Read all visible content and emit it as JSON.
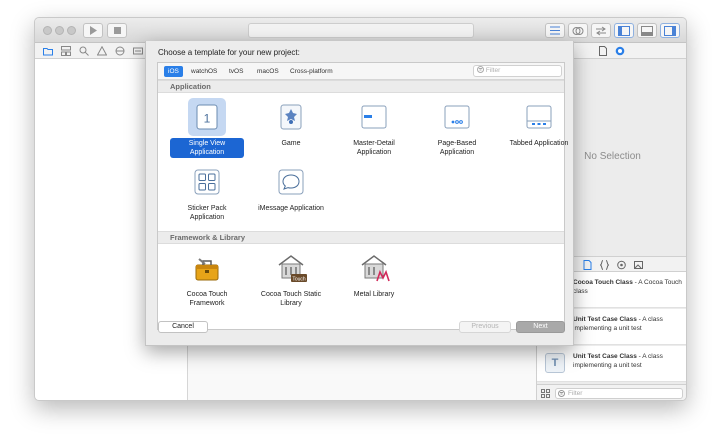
{
  "dialog": {
    "title": "Choose a template for your new project:",
    "platform_tabs": [
      "iOS",
      "watchOS",
      "tvOS",
      "macOS",
      "Cross-platform"
    ],
    "selected_tab": "iOS",
    "filter_placeholder": "Filter",
    "sections": [
      {
        "title": "Application",
        "templates": [
          {
            "label": "Single View Application",
            "icon": "single-view-icon",
            "selected": true
          },
          {
            "label": "Game",
            "icon": "game-icon"
          },
          {
            "label": "Master-Detail Application",
            "icon": "master-detail-icon"
          },
          {
            "label": "Page-Based Application",
            "icon": "page-based-icon"
          },
          {
            "label": "Tabbed Application",
            "icon": "tabbed-icon"
          },
          {
            "label": "Sticker Pack Application",
            "icon": "sticker-pack-icon"
          },
          {
            "label": "iMessage Application",
            "icon": "imessage-icon"
          }
        ]
      },
      {
        "title": "Framework & Library",
        "templates": [
          {
            "label": "Cocoa Touch Framework",
            "icon": "toolbox-icon"
          },
          {
            "label": "Cocoa Touch Static Library",
            "icon": "static-library-icon",
            "badge": "Touch"
          },
          {
            "label": "Metal Library",
            "icon": "metal-library-icon"
          }
        ]
      }
    ],
    "single_view_glyph": "1",
    "buttons": {
      "cancel": "Cancel",
      "previous": "Previous",
      "next": "Next"
    }
  },
  "inspector": {
    "no_selection": "No Selection"
  },
  "library": {
    "items": [
      {
        "title": "Cocoa Touch Class",
        "desc": " - A Cocoa Touch class"
      },
      {
        "title": "Unit Test Case Class",
        "desc": " - A class implementing a unit test"
      },
      {
        "title": "Unit Test Case Class",
        "desc": " - A class implementing a unit test",
        "glyph": "T"
      }
    ],
    "filter_placeholder": "Filter"
  },
  "colors": {
    "accent": "#1c66d3",
    "tab_selected": "#2a7fe8"
  }
}
